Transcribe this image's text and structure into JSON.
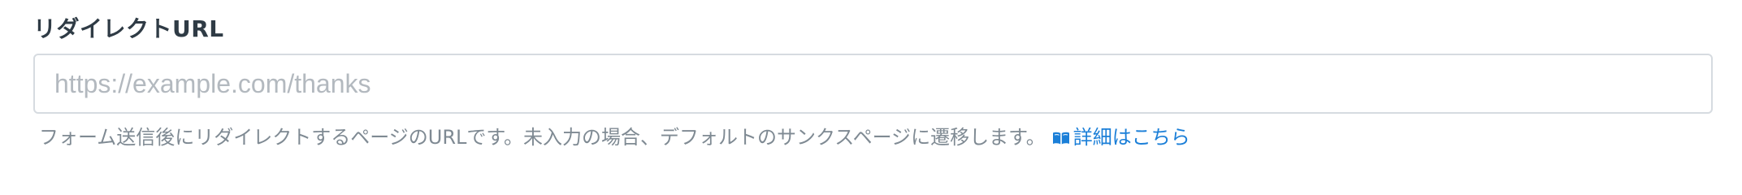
{
  "field": {
    "label": "リダイレクトURL",
    "input": {
      "value": "",
      "placeholder": "https://example.com/thanks"
    },
    "help_text": "フォーム送信後にリダイレクトするページのURLです。未入力の場合、デフォルトのサンクスページに遷移します。",
    "help_link": {
      "icon": "book-icon",
      "label": "詳細はこちら"
    }
  },
  "colors": {
    "label": "#2f3b45",
    "border": "#d6dbe0",
    "placeholder": "#b3b9bf",
    "help_text": "#7f8a93",
    "link": "#1b7fd8"
  }
}
